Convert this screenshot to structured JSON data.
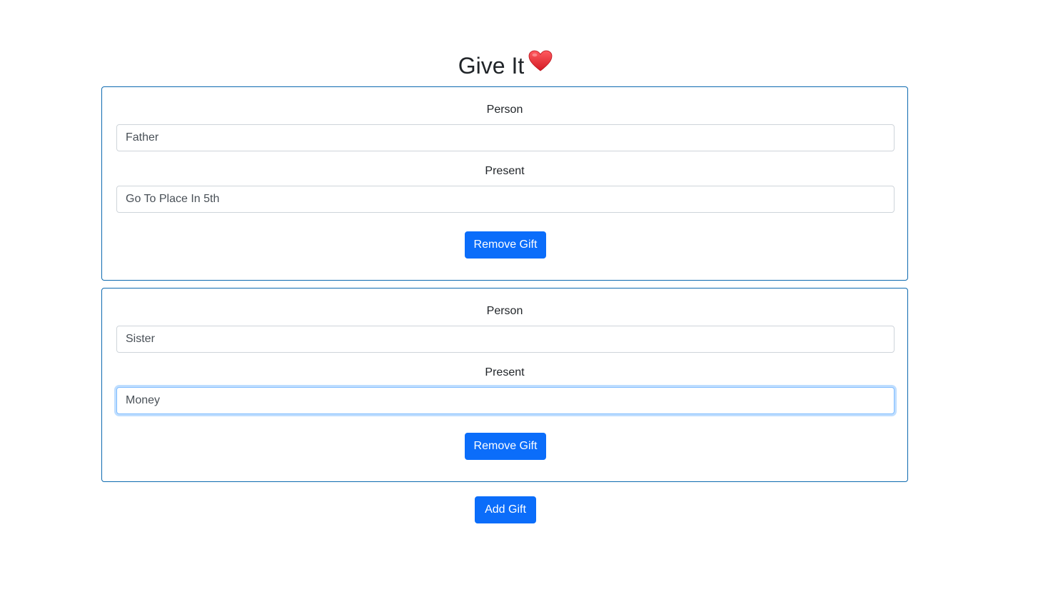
{
  "header": {
    "title": "Give It",
    "heart_icon": "heart-icon",
    "heart_color": "#e0242b"
  },
  "gifts": [
    {
      "person_label": "Person",
      "person_value": "Father",
      "present_label": "Present",
      "present_value": "Go To Place In 5th",
      "remove_label": "Remove Gift"
    },
    {
      "person_label": "Person",
      "person_value": "Sister",
      "present_label": "Present",
      "present_value": "Money",
      "remove_label": "Remove Gift"
    }
  ],
  "actions": {
    "add_label": "Add Gift"
  },
  "colors": {
    "primary": "#0b6dfa",
    "card_border": "#0d6ab0",
    "focus_border": "#80bdff"
  }
}
